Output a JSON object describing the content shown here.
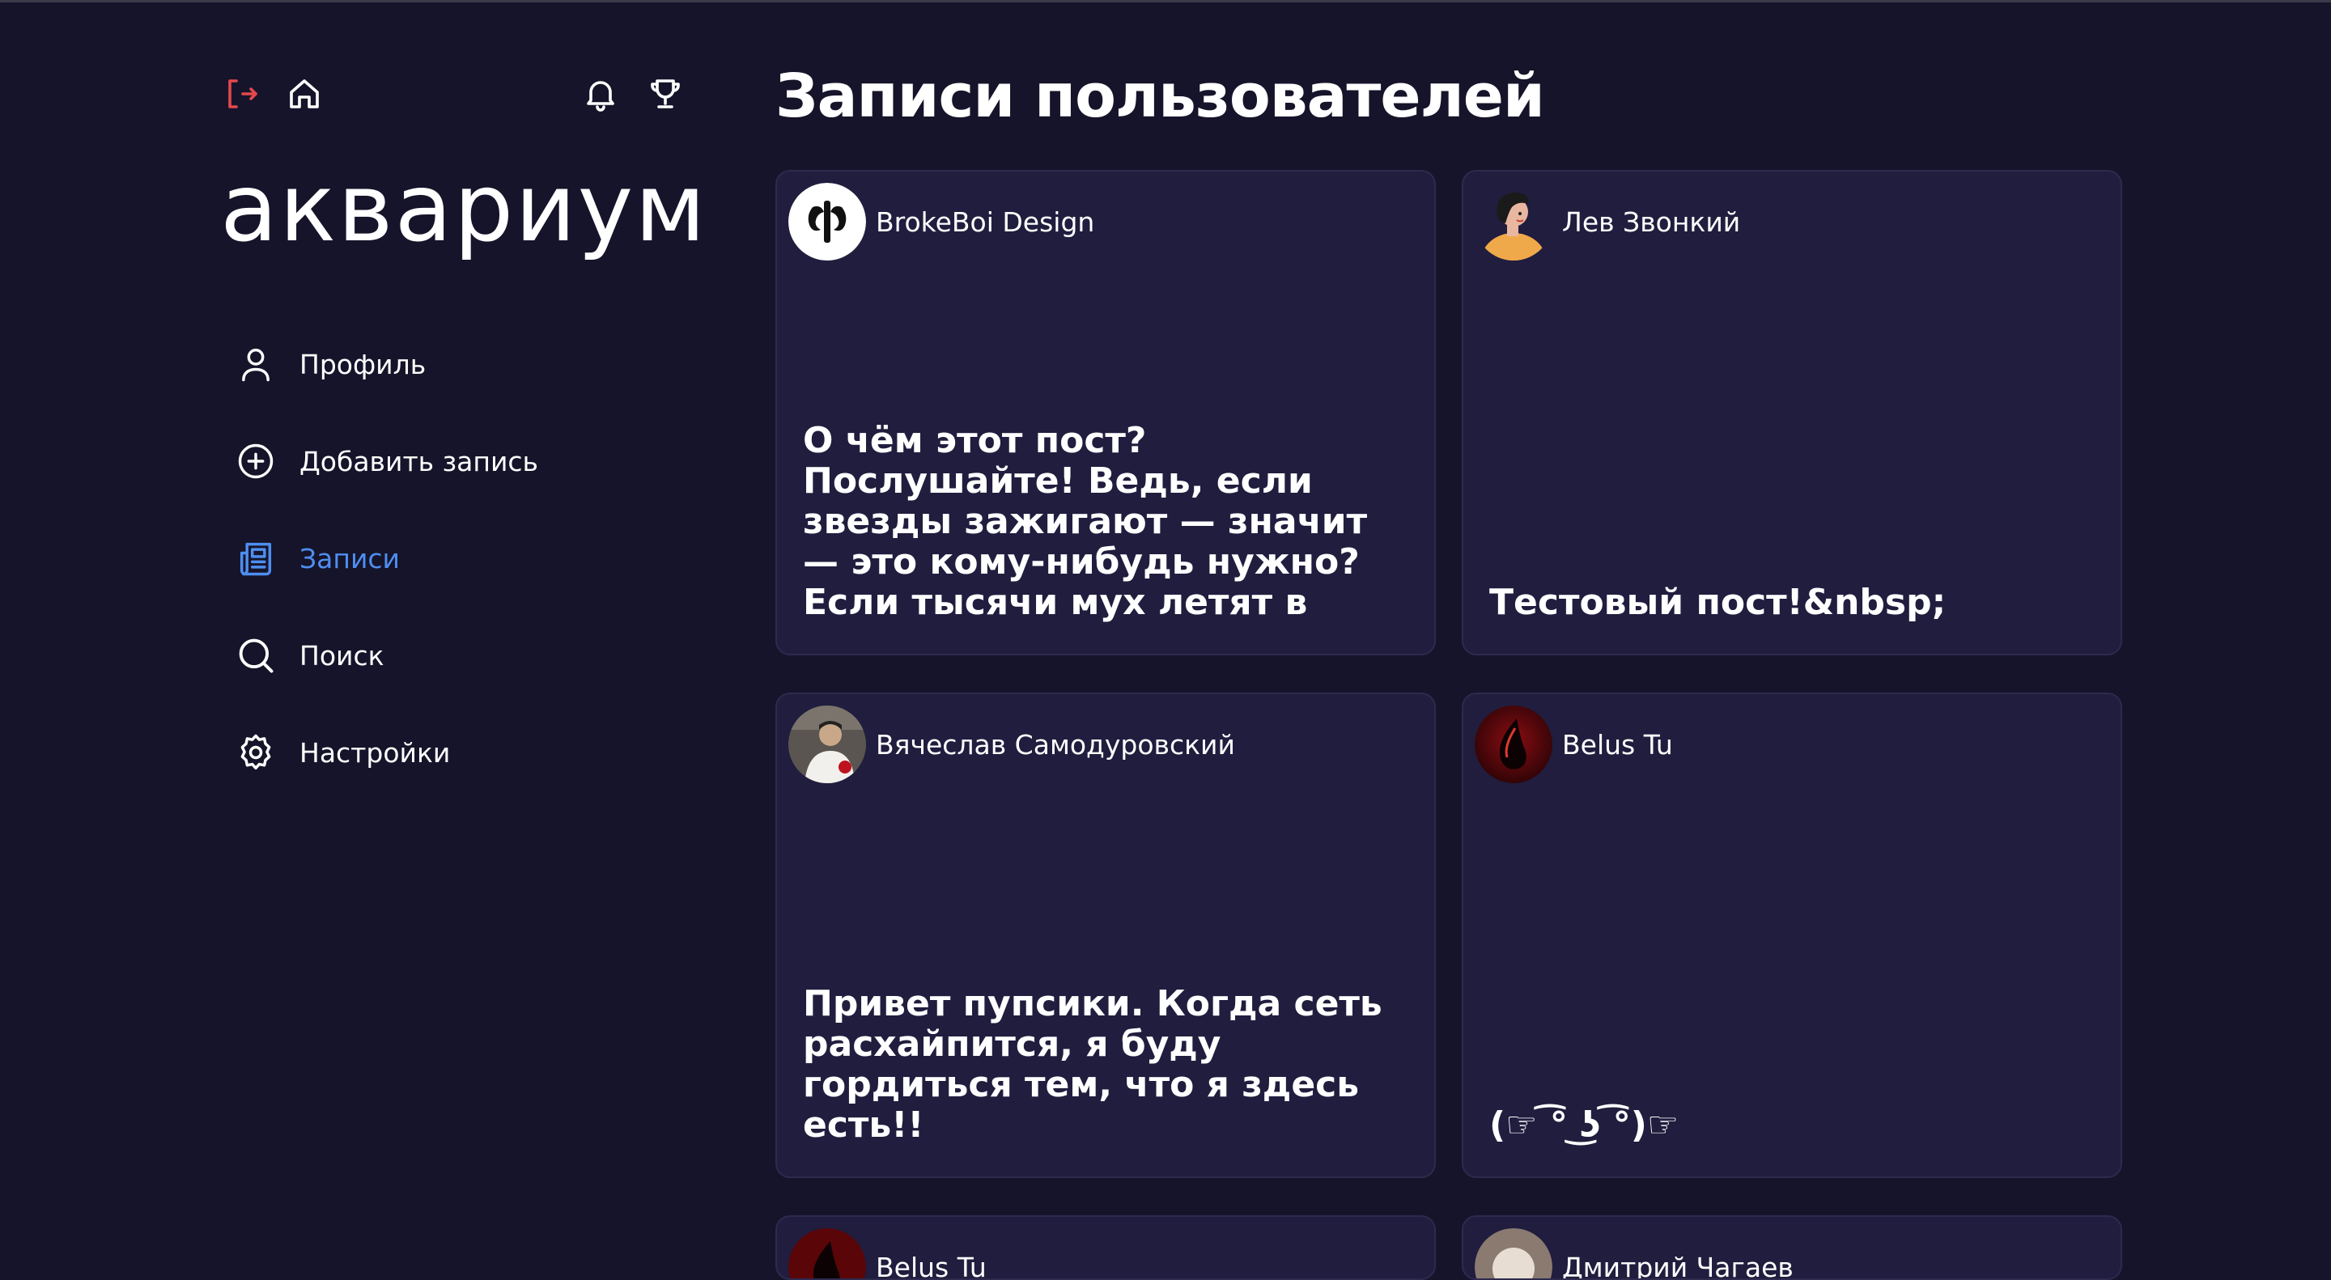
{
  "app": {
    "logo": "аквариум"
  },
  "sidebar": {
    "items": [
      {
        "label": "Профиль",
        "icon": "user-icon"
      },
      {
        "label": "Добавить запись",
        "icon": "plus-circle-icon"
      },
      {
        "label": "Записи",
        "icon": "newspaper-icon",
        "active": true
      },
      {
        "label": "Поиск",
        "icon": "search-icon"
      },
      {
        "label": "Настройки",
        "icon": "gear-icon"
      }
    ]
  },
  "main": {
    "title": "Записи пользователей",
    "posts": [
      {
        "author": "BrokeBoi Design",
        "text": "О чём этот пост?Послушайте! Ведь, если звезды зажигают — значит — это кому-нибудь нужно?Если тысячи мух летят в"
      },
      {
        "author": "Лев Звонкий",
        "text": "Тестовый пост!&nbsp;"
      },
      {
        "author": "Вячеслав Самодуровский",
        "text": "Привет пупсики. Когда сеть расхайпится, я буду гордиться тем, что я здесь есть!!"
      },
      {
        "author": "Belus Tu",
        "text": "(☞ ͡° ͜ʖ ͡°)☞"
      },
      {
        "author": "Belus Tu",
        "text": ""
      },
      {
        "author": "Дмитрий Чагаев",
        "text": ""
      }
    ]
  },
  "colors": {
    "background": "#16142a",
    "card": "#201d3e",
    "accent": "#4e8ef0",
    "logout": "#e5484d"
  }
}
